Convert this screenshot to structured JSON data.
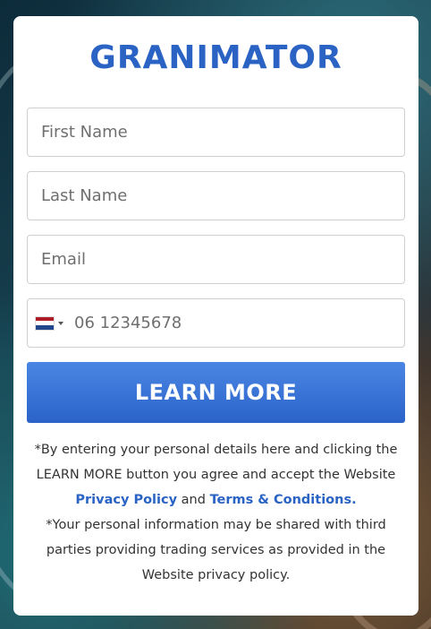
{
  "brand": "GRANIMATOR",
  "form": {
    "first_name_placeholder": "First Name",
    "last_name_placeholder": "Last Name",
    "email_placeholder": "Email",
    "phone_placeholder": "06 12345678",
    "country_flag": "netherlands-flag-icon",
    "submit_label": "LEARN MORE"
  },
  "disclaimer": {
    "line1": "*By entering your personal details here and clicking the LEARN MORE button you agree and accept the Website",
    "privacy_link": "Privacy Policy",
    "and": "and",
    "terms_link": "Terms & Conditions.",
    "line2": "*Your personal information may be shared with third parties providing trading services as provided in the Website privacy policy."
  },
  "colors": {
    "brand": "#2a63c4",
    "button_top": "#4b86e3",
    "button_bottom": "#2b63c9"
  }
}
